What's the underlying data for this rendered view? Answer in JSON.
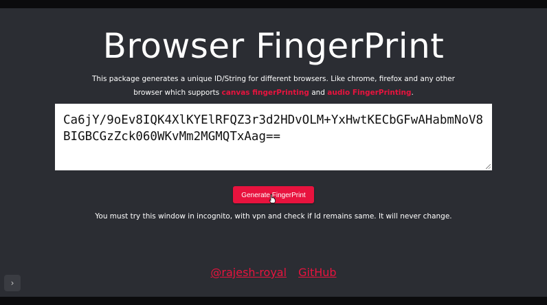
{
  "header": {
    "title": "Browser FingerPrint"
  },
  "description": {
    "text_before": "This package generates a unique ID/String for different browsers. Like chrome, firefox and any other browser which supports ",
    "link_canvas": "canvas fingerPrinting",
    "text_and": " and ",
    "link_audio": "audio FingerPrinting",
    "text_end": "."
  },
  "fingerprint": {
    "value": "Ca6jY/9oEv8IQK4XlKYElRFQZ3r3d2HDvOLM+YxHwtKECbGFwAHabmNoV8BIGBCGzZck060WKvMm2MGMQTxAag=="
  },
  "actions": {
    "generate_label": "Generate FingerPrint"
  },
  "note": "You must try this window in incognito, with vpn and check if Id remains same. It will never change.",
  "footer": {
    "author_link": "@rajesh-royal",
    "github_link": "GitHub"
  },
  "sidebar_toggle": {
    "glyph": "›"
  },
  "colors": {
    "accent": "#e8133e",
    "background": "#2b2d33",
    "text": "#ffffff"
  }
}
